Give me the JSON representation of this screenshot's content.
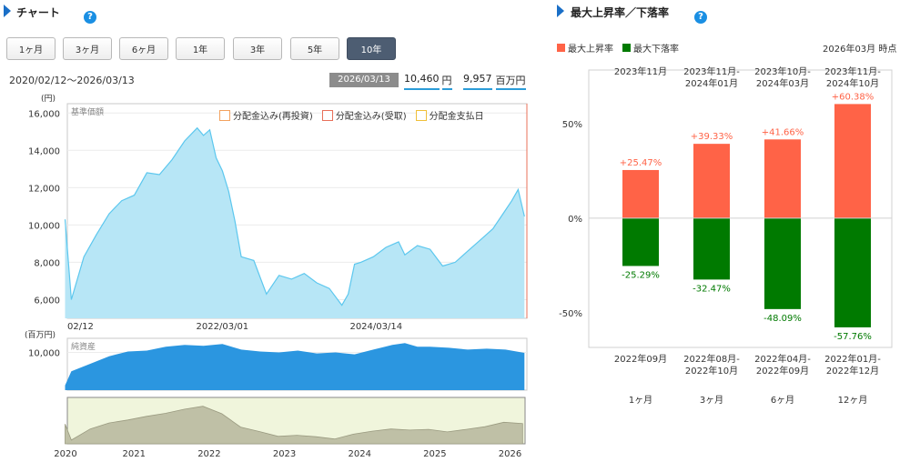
{
  "left": {
    "title": "チャート",
    "help": "?",
    "periods": [
      "1ヶ月",
      "3ヶ月",
      "6ヶ月",
      "1年",
      "3年",
      "5年",
      "10年"
    ],
    "active_period": "10年",
    "date_range": "2020/02/12〜2026/03/13",
    "as_of": "2026/03/13",
    "price": "10,460",
    "price_unit": "円",
    "assets": "9,957",
    "assets_unit": "百万円",
    "legend": {
      "reinvest": "分配金込み(再投資)",
      "received": "分配金込み(受取)",
      "payout_day": "分配金支払日"
    },
    "colors": {
      "reinvest": "#f3a25f",
      "received": "#e8705a",
      "payout_day": "#f0bf3a",
      "price_fill": "#b7e6f6",
      "price_line": "#5cc7ee",
      "asset_fill": "#2b96e0",
      "nav_fill": "#bfc0a6"
    }
  },
  "right": {
    "title": "最大上昇率／下落率",
    "help": "?",
    "legend_up": "最大上昇率",
    "legend_down": "最大下落率",
    "as_of": "2026年03月 時点",
    "colors": {
      "up": "#ff6347",
      "down": "#007a00"
    }
  },
  "chart_data": [
    {
      "type": "area",
      "title": "基準価額",
      "ylabel": "(円)",
      "ylim": [
        5000,
        16500
      ],
      "yticks": [
        "16,000",
        "14,000",
        "12,000",
        "10,000",
        "8,000",
        "6,000"
      ],
      "ytick_values": [
        16000,
        14000,
        12000,
        10000,
        8000,
        6000
      ],
      "xticks": [
        "02/12",
        "2022/03/01",
        "2024/03/14"
      ],
      "x": [
        "2020/02",
        "2020/03",
        "2020/05",
        "2020/07",
        "2020/09",
        "2020/11",
        "2021/01",
        "2021/03",
        "2021/05",
        "2021/07",
        "2021/09",
        "2021/11",
        "2021/12",
        "2022/01",
        "2022/02",
        "2022/03",
        "2022/04",
        "2022/05",
        "2022/06",
        "2022/08",
        "2022/10",
        "2022/12",
        "2023/02",
        "2023/04",
        "2023/06",
        "2023/08",
        "2023/10",
        "2023/11",
        "2023/12",
        "2024/01",
        "2024/03",
        "2024/05",
        "2024/07",
        "2024/08",
        "2024/10",
        "2024/12",
        "2025/02",
        "2025/04",
        "2025/06",
        "2025/08",
        "2025/10",
        "2025/12",
        "2026/01",
        "2026/02",
        "2026/03"
      ],
      "y": [
        10300,
        6000,
        8300,
        9500,
        10600,
        11300,
        11600,
        12800,
        12700,
        13500,
        14500,
        15200,
        14800,
        15100,
        13600,
        12900,
        11800,
        10200,
        8300,
        8100,
        6300,
        7300,
        7100,
        7400,
        6900,
        6600,
        5700,
        6300,
        7900,
        8000,
        8300,
        8800,
        9100,
        8400,
        8900,
        8700,
        7800,
        8000,
        8600,
        9200,
        9800,
        10800,
        11300,
        11900,
        10460
      ]
    },
    {
      "type": "area",
      "title": "純資産",
      "ylabel": "(百万円)",
      "yticks": [
        "10,000"
      ],
      "ytick_values": [
        10000
      ],
      "ylim": [
        6000,
        11500
      ],
      "x": [
        "2020/02",
        "2020/03",
        "2020/06",
        "2020/09",
        "2020/12",
        "2021/03",
        "2021/06",
        "2021/09",
        "2021/12",
        "2022/03",
        "2022/06",
        "2022/09",
        "2022/12",
        "2023/03",
        "2023/06",
        "2023/09",
        "2023/12",
        "2024/03",
        "2024/06",
        "2024/08",
        "2024/10",
        "2024/12",
        "2025/03",
        "2025/06",
        "2025/09",
        "2025/12",
        "2026/03"
      ],
      "y": [
        6500,
        8000,
        8800,
        9600,
        10100,
        10200,
        10600,
        10800,
        10700,
        10900,
        10300,
        10100,
        10000,
        10200,
        9900,
        10000,
        9800,
        10300,
        10800,
        11000,
        10600,
        10600,
        10500,
        10300,
        10400,
        10300,
        9957
      ]
    },
    {
      "type": "area",
      "title": "",
      "xticks": [
        "2020",
        "2021",
        "2022",
        "2023",
        "2024",
        "2025",
        "2026"
      ],
      "ylim": [
        5000,
        16500
      ],
      "x": [
        "2020/02",
        "2020/03",
        "2020/06",
        "2020/09",
        "2020/12",
        "2021/03",
        "2021/06",
        "2021/09",
        "2021/12",
        "2022/03",
        "2022/06",
        "2022/09",
        "2022/12",
        "2023/03",
        "2023/06",
        "2023/09",
        "2023/12",
        "2024/03",
        "2024/06",
        "2024/09",
        "2024/12",
        "2025/03",
        "2025/06",
        "2025/09",
        "2025/12",
        "2026/03"
      ],
      "y": [
        10300,
        6000,
        9000,
        10600,
        11400,
        12400,
        13200,
        14300,
        15100,
        13100,
        9500,
        8300,
        7000,
        7300,
        6900,
        6300,
        7600,
        8400,
        9000,
        8700,
        8900,
        8200,
        8900,
        9600,
        10800,
        10460
      ]
    },
    {
      "type": "bar",
      "title": "最大上昇率／下落率",
      "categories": [
        "1ヶ月",
        "3ヶ月",
        "6ヶ月",
        "12ヶ月"
      ],
      "ylim": [
        -65,
        75
      ],
      "yticks": [
        "50%",
        "0%",
        "-50%"
      ],
      "ytick_values": [
        50,
        0,
        -50
      ],
      "series": [
        {
          "name": "最大上昇率",
          "values": [
            25.47,
            39.33,
            41.66,
            60.38
          ],
          "labels": [
            "+25.47%",
            "+39.33%",
            "+41.66%",
            "+60.38%"
          ],
          "periods": [
            "2023年11月",
            "2023年11月-\n2024年01月",
            "2023年10月-\n2024年03月",
            "2023年11月-\n2024年10月"
          ]
        },
        {
          "name": "最大下落率",
          "values": [
            -25.29,
            -32.47,
            -48.09,
            -57.76
          ],
          "labels": [
            "-25.29%",
            "-32.47%",
            "-48.09%",
            "-57.76%"
          ],
          "periods": [
            "2022年09月",
            "2022年08月-\n2022年10月",
            "2022年04月-\n2022年09月",
            "2022年01月-\n2022年12月"
          ]
        }
      ]
    }
  ]
}
